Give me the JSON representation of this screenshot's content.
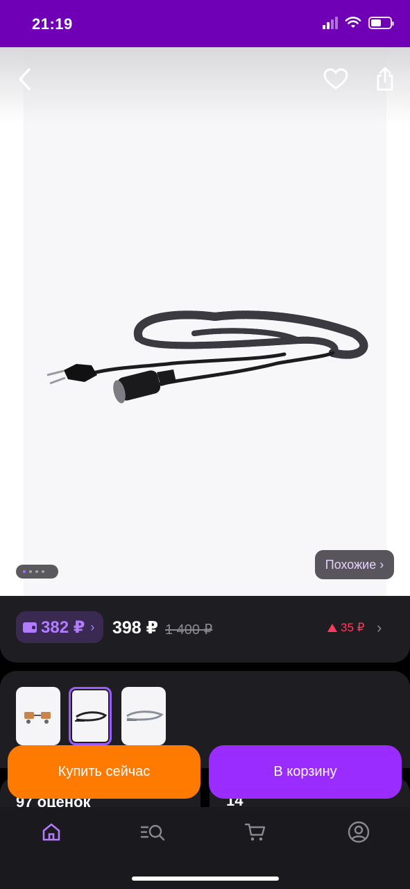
{
  "status_bar": {
    "time": "21:19"
  },
  "product": {
    "similar_label": "Похожие ›",
    "gallery_pages": 4,
    "gallery_active_page": 1
  },
  "price": {
    "wallet_price": "382 ₽",
    "current_price": "398 ₽",
    "old_price": "1 400 ₽",
    "bonus": "35 ₽"
  },
  "variants": {
    "count": 3,
    "selected_index": 1
  },
  "reviews": {
    "ratings_label": "97 оценок",
    "questions_label": "14"
  },
  "actions": {
    "buy_now": "Купить сейчас",
    "add_to_cart": "В корзину"
  },
  "colors": {
    "brand_purple": "#6f00b5",
    "accent_purple": "#9b2cff",
    "accent_orange": "#ff7a00",
    "bonus_red": "#ff3b5c"
  },
  "icons": [
    "back-arrow-icon",
    "heart-icon",
    "share-icon",
    "wallet-icon",
    "home-icon",
    "catalog-search-icon",
    "cart-icon",
    "profile-icon"
  ]
}
